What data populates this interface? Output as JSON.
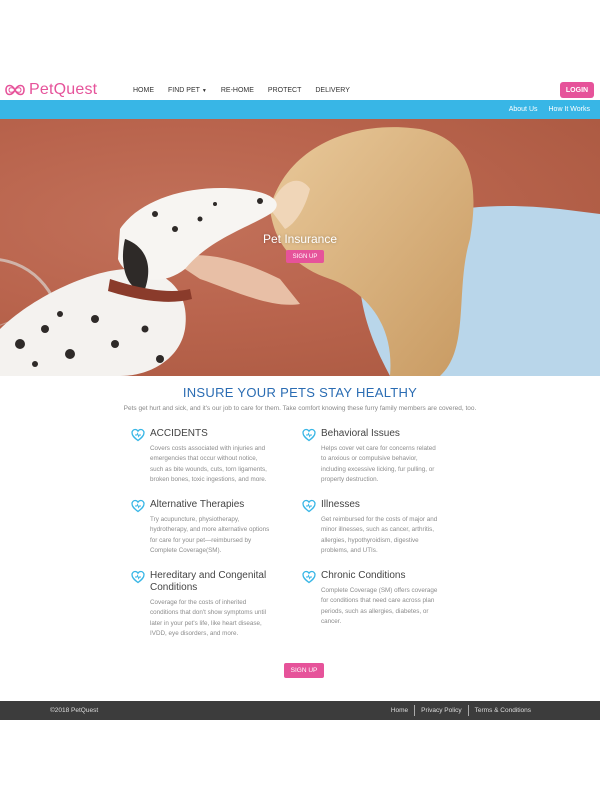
{
  "brand": {
    "name": "PetQuest"
  },
  "nav": {
    "items": [
      {
        "label": "HOME"
      },
      {
        "label": "FIND PET"
      },
      {
        "label": "RE-HOME"
      },
      {
        "label": "PROTECT"
      },
      {
        "label": "DELIVERY"
      }
    ],
    "login_label": "LOGIN"
  },
  "subnav": {
    "items": [
      {
        "label": "About Us"
      },
      {
        "label": "How It Works"
      }
    ]
  },
  "hero": {
    "title": "Pet Insurance",
    "cta_label": "SIGN UP"
  },
  "section": {
    "title": "INSURE YOUR PETS STAY HEALTHY",
    "subtitle": "Pets get hurt and sick, and it's our job to care for them. Take comfort knowing these furry family members are covered, too."
  },
  "features": [
    {
      "title": "ACCIDENTS",
      "desc": [
        "Covers costs associated with injuries and",
        "emergencies that occur without notice,",
        "such as bite wounds, cuts, torn ligaments,",
        "broken bones, toxic ingestions, and more."
      ],
      "icon": "heart-icon"
    },
    {
      "title": "Behavioral Issues",
      "desc": [
        "Helps cover vet care for concerns related",
        "to anxious or compulsive behavior,",
        "including excessive licking, fur pulling, or",
        "property destruction."
      ],
      "icon": "heart-icon"
    },
    {
      "title": "Alternative Therapies",
      "desc": [
        "Try acupuncture, physiotherapy,",
        "hydrotherapy, and more alternative options",
        "for care for your pet—reimbursed by",
        "Complete Coverage(SM)."
      ],
      "icon": "heart-icon"
    },
    {
      "title": "Illnesses",
      "desc": [
        "Get reimbursed for the costs of major and",
        "minor illnesses, such as cancer, arthritis,",
        "allergies, hypothyroidism, digestive",
        "problems, and UTIs."
      ],
      "icon": "heart-icon"
    },
    {
      "title": [
        "Hereditary and Congenital",
        "Conditions"
      ],
      "desc": [
        "Coverage for the costs of inherited",
        "conditions that don't show symptoms until",
        "later in your pet's life, like heart disease,",
        "IVDD, eye disorders, and more."
      ],
      "icon": "heart-icon"
    },
    {
      "title": "Chronic Conditions",
      "desc": [
        "Complete Coverage (SM) offers coverage",
        "for conditions that need care across plan",
        "periods, such as allergies, diabetes, or",
        "cancer."
      ],
      "icon": "heart-icon"
    }
  ],
  "cta": {
    "label": "SIGN UP"
  },
  "footer": {
    "copyright": "©2018 PetQuest",
    "links": [
      {
        "label": "Home"
      },
      {
        "label": "Privacy Policy"
      },
      {
        "label": "Terms & Conditions"
      }
    ]
  },
  "colors": {
    "accent": "#e6539a",
    "subbar": "#38b6e6",
    "heading": "#2a6cb3",
    "footer": "#3c3c3c"
  }
}
